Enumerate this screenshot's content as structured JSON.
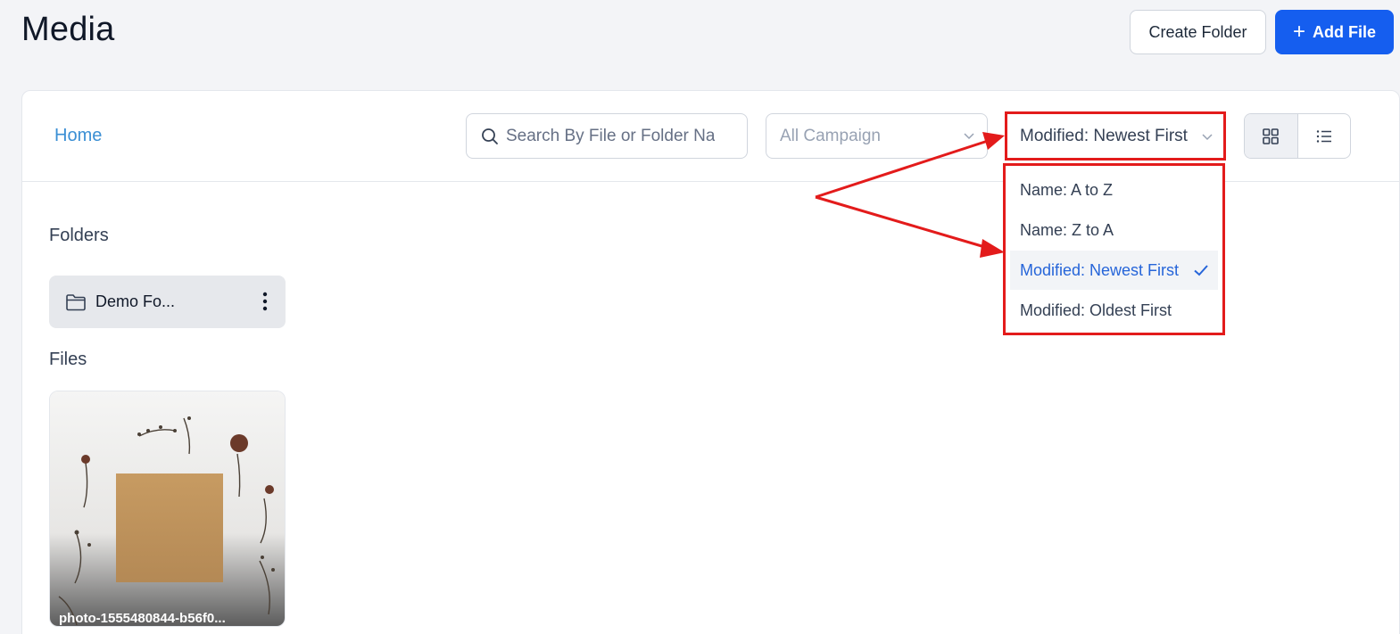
{
  "header": {
    "title": "Media",
    "create_folder_label": "Create Folder",
    "add_file_label": "Add File"
  },
  "toolbar": {
    "breadcrumb_home": "Home",
    "search_placeholder": "Search By File or Folder Name",
    "campaign_placeholder": "All Campaign",
    "sort_selected": "Modified: Newest First",
    "view_modes": [
      "grid",
      "list"
    ],
    "active_view": "grid"
  },
  "sort_menu": {
    "options": [
      {
        "label": "Name: A to Z",
        "selected": false
      },
      {
        "label": "Name: Z to A",
        "selected": false
      },
      {
        "label": "Modified: Newest First",
        "selected": true
      },
      {
        "label": "Modified: Oldest First",
        "selected": false
      }
    ]
  },
  "folders": {
    "heading": "Folders",
    "items": [
      {
        "name": "Demo Fo..."
      }
    ]
  },
  "files": {
    "heading": "Files",
    "items": [
      {
        "name": "photo-1555480844-b56f0..."
      }
    ]
  },
  "colors": {
    "primary": "#155eef",
    "annotation_red": "#e31b1b",
    "link": "#3b8fd4",
    "selected_text": "#2665d9"
  }
}
